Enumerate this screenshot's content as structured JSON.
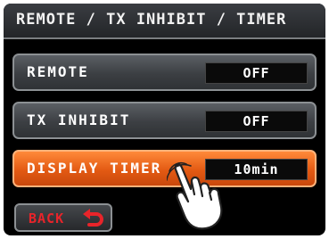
{
  "header": {
    "title": "REMOTE / TX INHIBIT / TIMER"
  },
  "settings": [
    {
      "label": "REMOTE",
      "value": "OFF"
    },
    {
      "label": "TX INHIBIT",
      "value": "OFF"
    },
    {
      "label": "DISPLAY TIMER",
      "value": "10min"
    }
  ],
  "footer": {
    "back_label": "BACK"
  },
  "colors": {
    "accent": "#e35a13",
    "back_text": "#e8242a",
    "background": "#000000"
  },
  "icons": {
    "back": "back-arrow-icon",
    "pointer": "pointing-hand-icon"
  }
}
